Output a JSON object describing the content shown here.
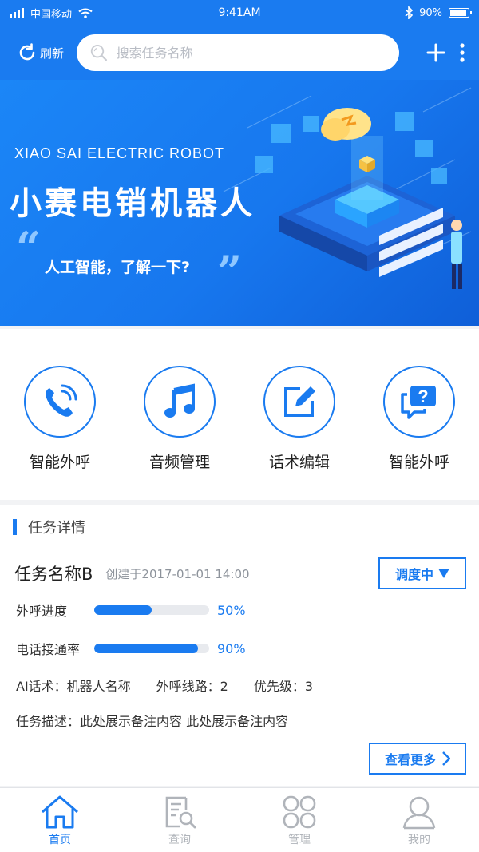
{
  "status_bar": {
    "carrier": "中国移动",
    "time": "9:41AM",
    "battery": "90%",
    "battery_level": 0.9
  },
  "navbar": {
    "refresh_label": "刷新",
    "search_placeholder": "搜索任务名称"
  },
  "banner": {
    "en_title": "XIAO SAI ELECTRIC ROBOT",
    "cn_title": "小赛电销机器人",
    "slogan": "人工智能，了解一下?",
    "open_quote": "“",
    "close_quote": "”"
  },
  "features": [
    {
      "label": "智能外呼",
      "icon": "phone-call-icon"
    },
    {
      "label": "音频管理",
      "icon": "music-note-icon"
    },
    {
      "label": "话术编辑",
      "icon": "edit-icon"
    },
    {
      "label": "智能外呼",
      "icon": "chat-question-icon"
    }
  ],
  "task_detail": {
    "section_title": "任务详情",
    "task_name": "任务名称B",
    "created": "创建于2017-01-01 14:00",
    "status_label": "调度中",
    "progress": [
      {
        "label": "外呼进度",
        "value_text": "50%",
        "value": 0.5
      },
      {
        "label": "电话接通率",
        "value_text": "90%",
        "value": 0.9
      }
    ],
    "ai_script": "AI话术：机器人名称",
    "line": "外呼线路：2",
    "priority": "优先级：3",
    "description": "任务描述：此处展示备注内容 此处展示备注内容",
    "more_label": "查看更多"
  },
  "tabs": [
    {
      "label": "首页",
      "icon": "home-icon",
      "active": true
    },
    {
      "label": "查询",
      "icon": "search-document-icon",
      "active": false
    },
    {
      "label": "管理",
      "icon": "grid-icon",
      "active": false
    },
    {
      "label": "我的",
      "icon": "user-icon",
      "active": false
    }
  ],
  "colors": {
    "accent": "#1a7bf0",
    "inactive": "#b0b4ba"
  }
}
